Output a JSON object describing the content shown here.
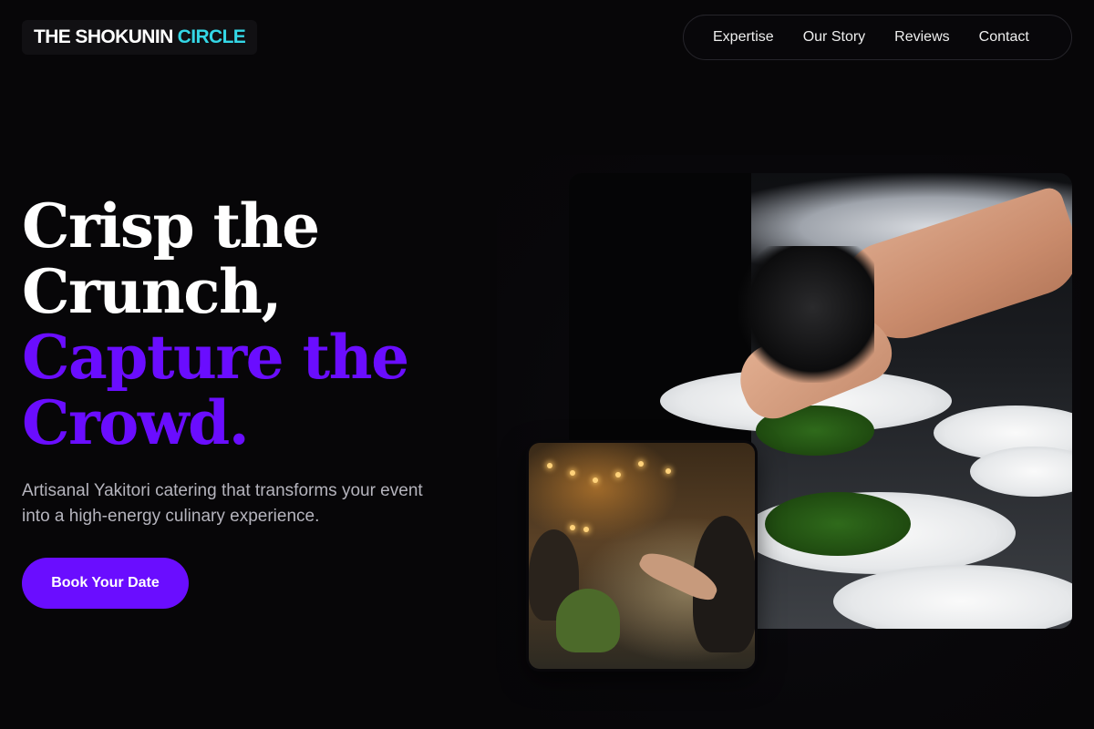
{
  "brand": {
    "name_primary": "THE SHOKUNIN",
    "name_accent": "CIRCLE",
    "accent_color": "#34d7e6"
  },
  "nav": {
    "items": [
      {
        "label": "Expertise"
      },
      {
        "label": "Our Story"
      },
      {
        "label": "Reviews"
      },
      {
        "label": "Contact"
      }
    ]
  },
  "hero": {
    "headline_line_1": "Crisp the",
    "headline_line_2": "Crunch,",
    "headline_line_3": "Capture the",
    "headline_line_4": "Crowd.",
    "headline_accent_color": "#6a0dff",
    "subtitle": "Artisanal Yakitori catering that transforms your event into a high-energy culinary experience.",
    "cta_label": "Book Your Date"
  },
  "images": {
    "main_photo_alt": "chef-plating-dishes",
    "secondary_photo_alt": "guests-toasting-at-event"
  }
}
